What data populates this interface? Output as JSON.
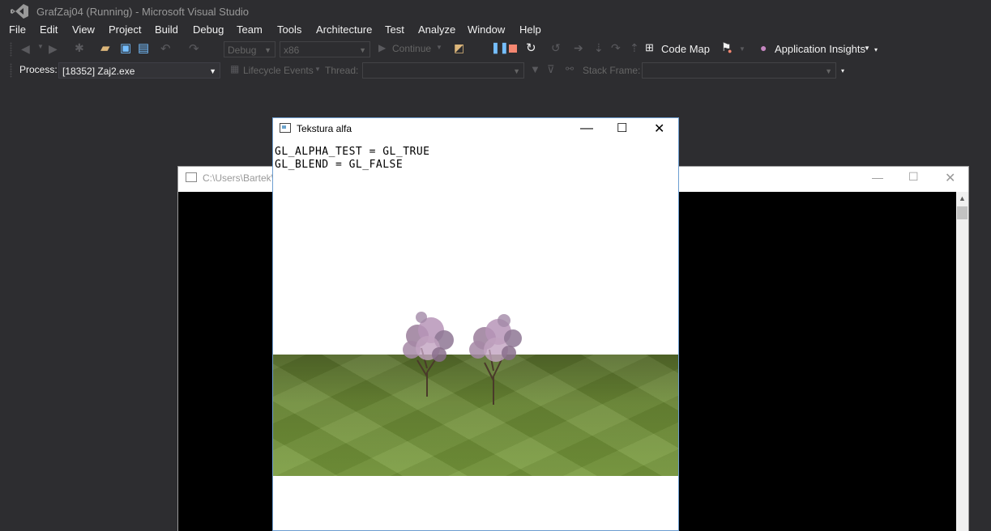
{
  "vs": {
    "title": "GrafZaj04 (Running) - Microsoft Visual Studio",
    "menu": [
      "File",
      "Edit",
      "View",
      "Project",
      "Build",
      "Debug",
      "Team",
      "Tools",
      "Architecture",
      "Test",
      "Analyze",
      "Window",
      "Help"
    ],
    "toolbar": {
      "config": "Debug",
      "platform": "x86",
      "continue": "Continue",
      "code_map": "Code Map",
      "app_insights": "Application Insights"
    },
    "debug_location": {
      "process_label": "Process:",
      "process_value": "[18352] Zaj2.exe",
      "lifecycle": "Lifecycle Events",
      "thread_label": "Thread:",
      "stack_label": "Stack Frame:"
    }
  },
  "console_window": {
    "title": "C:\\Users\\Bartek\\"
  },
  "gl_window": {
    "title": "Tekstura alfa",
    "lines": [
      "GL_ALPHA_TEST = GL_TRUE",
      "GL_BLEND = GL_FALSE"
    ]
  },
  "colors": {
    "vs_bg": "#2d2d30",
    "accent_blue": "#75beff",
    "stop_red": "#f48771",
    "bulb_purple": "#c586c0"
  }
}
